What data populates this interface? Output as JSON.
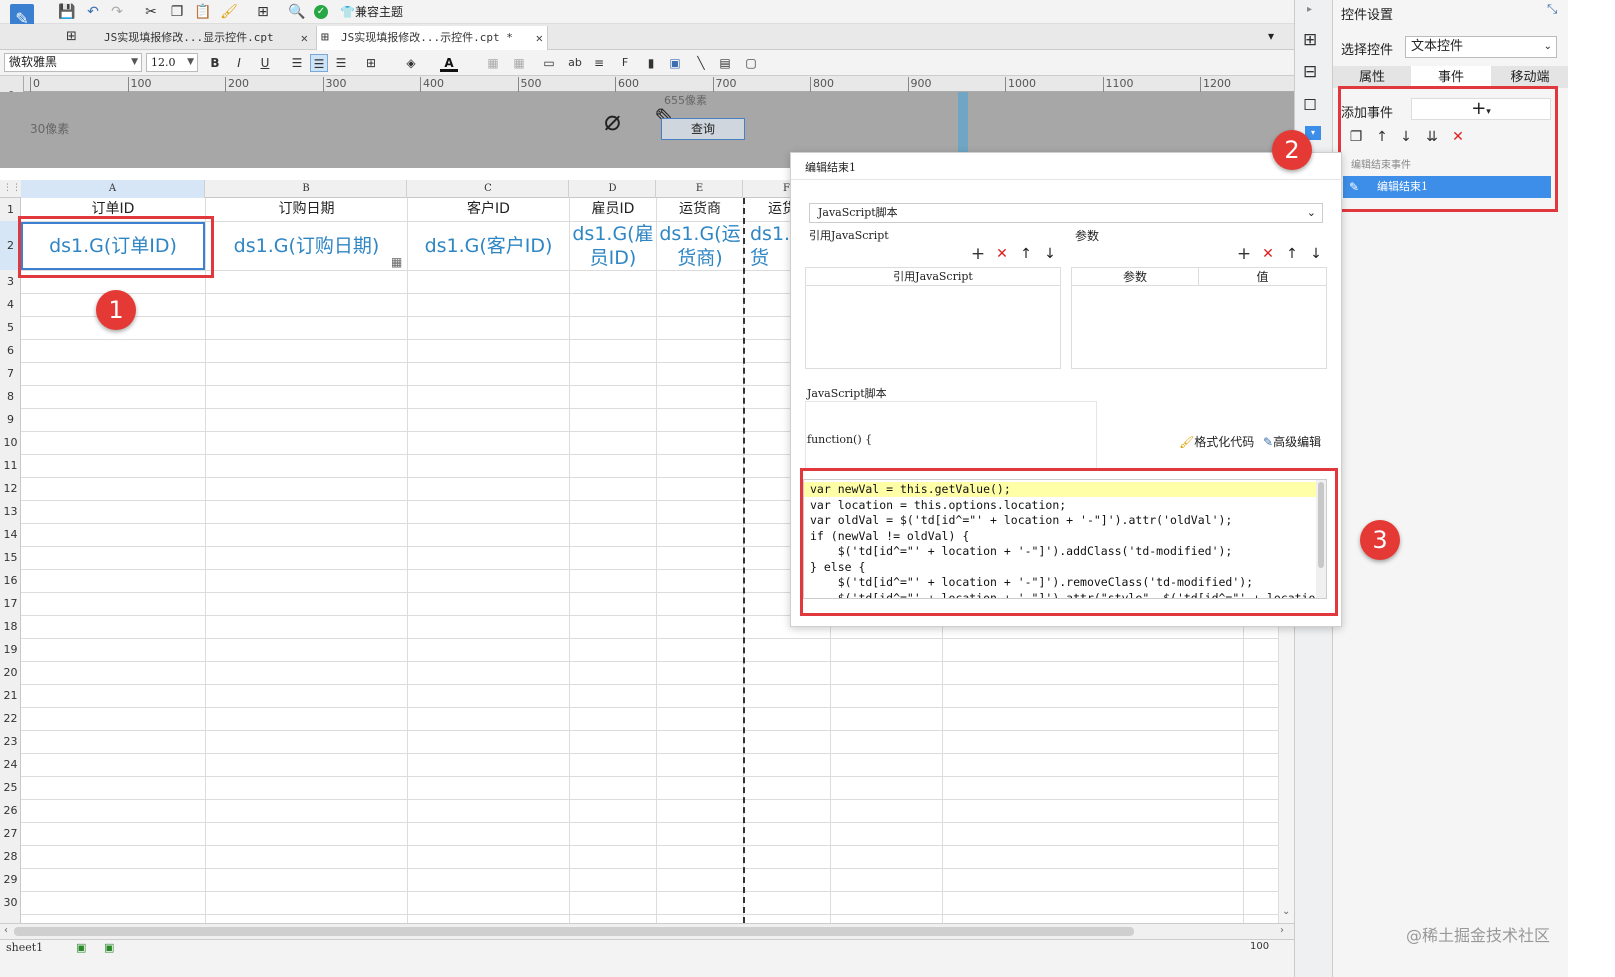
{
  "toolbar": {
    "theme_label": "兼容主题"
  },
  "tabs": [
    {
      "label": "JS实现填报修改...显示控件.cpt"
    },
    {
      "label": "JS实现填报修改...示控件.cpt *"
    }
  ],
  "format_toolbar": {
    "font": "微软雅黑",
    "size": "12.0"
  },
  "ruler": {
    "ticks": [
      "0",
      "100",
      "200",
      "300",
      "400",
      "500",
      "600",
      "700",
      "800",
      "900",
      "1000",
      "1100",
      "1200"
    ]
  },
  "form_area": {
    "height_label": "30像素",
    "width_label": "655像素",
    "query_button": "查询"
  },
  "sheet": {
    "columns": [
      "A",
      "B",
      "C",
      "D",
      "E",
      "F"
    ],
    "rows": [
      "1",
      "2",
      "3",
      "4",
      "5",
      "6",
      "7",
      "8",
      "9",
      "10",
      "11",
      "12",
      "13",
      "14",
      "15",
      "16",
      "17",
      "18",
      "19",
      "20",
      "21",
      "22",
      "23",
      "24",
      "25",
      "26",
      "27",
      "28",
      "29",
      "30"
    ],
    "headers": [
      "订单ID",
      "订购日期",
      "客户ID",
      "雇员ID",
      "运货商",
      "运货"
    ],
    "cells": [
      "ds1.G(订单ID)",
      "ds1.G(订购日期)",
      "ds1.G(客户ID)",
      "ds1.G(雇员ID)",
      "ds1.G(运货商)",
      "ds1.G(运货"
    ],
    "tab_name": "sheet1",
    "zoom": "100"
  },
  "right_panel": {
    "title": "控件设置",
    "select_label": "选择控件",
    "select_value": "文本控件",
    "tabs": [
      "属性",
      "事件",
      "移动端"
    ],
    "add_event_label": "添加事件",
    "group_label": "编辑结束事件",
    "event_item": "编辑结束1"
  },
  "dialog": {
    "title": "编辑结束1",
    "type_value": "JavaScript脚本",
    "ref_js_label": "引用JavaScript",
    "params_label": "参数",
    "col_ref_js": "引用JavaScript",
    "col_param": "参数",
    "col_value": "值",
    "script_label": "JavaScript脚本",
    "function_header": "function() {",
    "format_code": "格式化代码",
    "advanced_edit": "高级编辑",
    "code": [
      "var newVal = this.getValue();",
      "var location = this.options.location;",
      "var oldVal = $('td[id^=\"' + location + '-\"]').attr('oldVal');",
      "if (newVal != oldVal) {",
      "    $('td[id^=\"' + location + '-\"]').addClass('td-modified');",
      "} else {",
      "    $('td[id^=\"' + location + '-\"]').removeClass('td-modified');",
      "    $('td[id^=\"' + location + '-\"]').attr(\"style\", $('td[id^=\"' + location",
      "}"
    ]
  },
  "annotations": [
    "1",
    "2",
    "3"
  ],
  "watermark": "@稀土掘金技术社区",
  "colors": {
    "accent": "#3d8ee8",
    "highlight": "#e0383d",
    "cell_text": "#2f86c4"
  }
}
